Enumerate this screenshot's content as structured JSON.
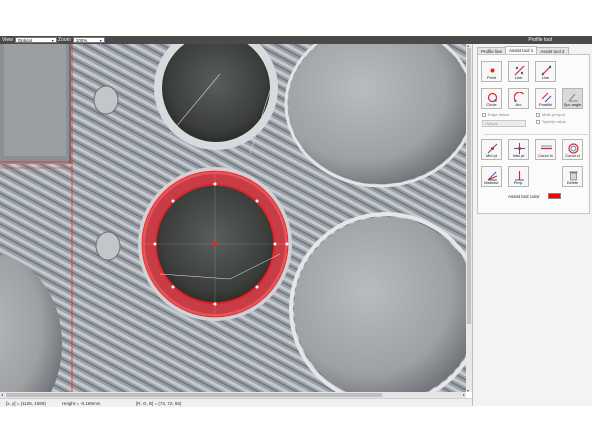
{
  "toolbar": {
    "view_label": "View",
    "view_value": "Optical",
    "zoom_label": "Zoom",
    "zoom_value": "100%",
    "right_title": "Profile tool"
  },
  "panel": {
    "tabs": [
      {
        "label": "Profile line"
      },
      {
        "label": "Assist tool 1"
      },
      {
        "label": "Assist tool 2"
      }
    ],
    "tools_row1": [
      {
        "label": "Point",
        "icon": "point-icon"
      },
      {
        "label": "Line",
        "icon": "line-icon"
      },
      {
        "label": "Line",
        "icon": "line-2pt-icon"
      }
    ],
    "tools_row2": [
      {
        "label": "Circle",
        "icon": "circle-icon"
      },
      {
        "label": "Arc",
        "icon": "arc-icon"
      },
      {
        "label": "Parallel",
        "icon": "parallel-icon"
      },
      {
        "label": "Spc angle",
        "icon": "angle-icon"
      }
    ],
    "options": {
      "edge_detect": "Edge detect",
      "multi_pt_input": "Multi-pt input",
      "specify_value": "Specify value",
      "source_value": "Optical"
    },
    "tools_row3": [
      {
        "label": "Mid pt",
        "icon": "midpoint-icon"
      },
      {
        "label": "Intsl pt",
        "icon": "intersection-icon"
      },
      {
        "label": "Conct ln",
        "icon": "concentric-line-icon"
      },
      {
        "label": "Conct cl",
        "icon": "concentric-circle-icon"
      }
    ],
    "tools_row4": [
      {
        "label": "Bisector",
        "icon": "bisector-icon"
      },
      {
        "label": "Perp.",
        "icon": "perpendicular-icon"
      },
      {
        "label": "Delete",
        "icon": "delete-icon"
      }
    ],
    "assist_color_label": "Assist tool color",
    "assist_color": "#ff0000"
  },
  "status": {
    "xy": "[x, y] = (1105, 1089)",
    "height": "Height  = -0.169mm",
    "rgb": "[R, G, B] = (73, 72, 66)"
  },
  "colors": {
    "overlay_red": "#e8202a",
    "frame_dark": "#4a4a4a"
  }
}
